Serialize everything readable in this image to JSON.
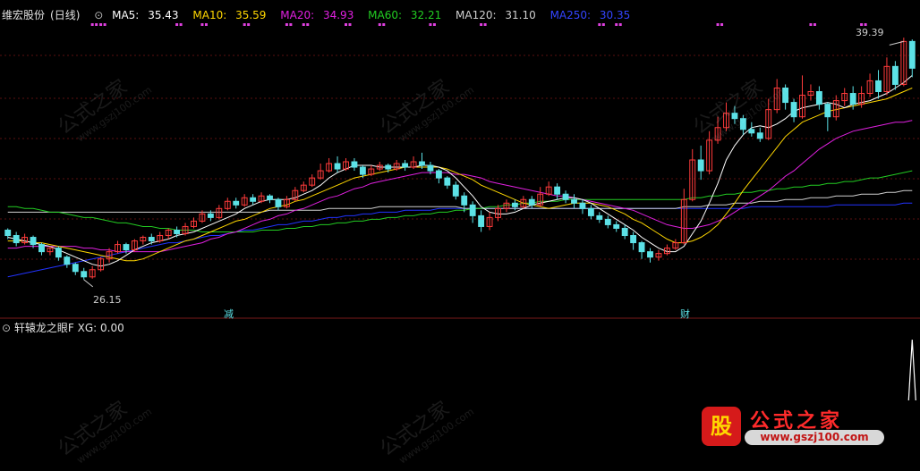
{
  "header": {
    "stock": "维宏股份",
    "period": "(日线)",
    "ma5_label": "MA5:",
    "ma5_value": "35.43",
    "ma10_label": "MA10:",
    "ma10_value": "35.59",
    "ma20_label": "MA20:",
    "ma20_value": "34.93",
    "ma60_label": "MA60:",
    "ma60_value": "32.21",
    "ma120_label": "MA120:",
    "ma120_value": "31.10",
    "ma250_label": "MA250:",
    "ma250_value": "30.35"
  },
  "colors": {
    "up": "#ff3b3b",
    "down": "#5ce1e6",
    "ma5": "#ffffff",
    "ma10": "#ffd700",
    "ma20": "#e020e0",
    "ma60": "#22cc22",
    "ma120": "#cfcfcf",
    "ma250": "#2233ff",
    "marker": "#e040e0",
    "grid": "#5a1010"
  },
  "annotations": {
    "high_price": "39.39",
    "low_price": "26.15",
    "signal_1": "减",
    "signal_2": "财"
  },
  "indicator": {
    "name": "轩辕龙之眼F",
    "xg_label": "XG:",
    "xg_value": "0.00"
  },
  "watermark": {
    "text": "公式之家",
    "url": "www.gszj100.com"
  },
  "logo": {
    "title": "公式之家",
    "url": "www.gszj100.com"
  },
  "chart_data": {
    "type": "candlestick",
    "price_range": [
      24.8,
      40.6
    ],
    "high": 39.39,
    "low": 26.15,
    "ma_last": {
      "MA5": 35.43,
      "MA10": 35.59,
      "MA20": 34.93,
      "MA60": 32.21,
      "MA120": 31.1,
      "MA250": 30.35
    },
    "candles": [
      [
        28.9,
        28.6,
        29.0,
        28.4
      ],
      [
        28.6,
        28.2,
        28.8,
        28.0
      ],
      [
        28.2,
        28.5,
        28.7,
        28.1
      ],
      [
        28.5,
        28.1,
        28.6,
        27.9
      ],
      [
        28.1,
        27.7,
        28.2,
        27.5
      ],
      [
        27.7,
        27.9,
        28.0,
        27.5
      ],
      [
        27.9,
        27.4,
        28.0,
        27.2
      ],
      [
        27.4,
        27.0,
        27.5,
        26.8
      ],
      [
        27.0,
        26.6,
        27.1,
        26.4
      ],
      [
        26.6,
        26.3,
        26.8,
        26.15
      ],
      [
        26.3,
        26.7,
        26.9,
        26.2
      ],
      [
        26.7,
        27.3,
        27.4,
        26.6
      ],
      [
        27.3,
        27.7,
        27.9,
        27.1
      ],
      [
        27.7,
        28.1,
        28.3,
        27.6
      ],
      [
        28.1,
        27.8,
        28.2,
        27.6
      ],
      [
        27.8,
        28.3,
        28.4,
        27.7
      ],
      [
        28.3,
        28.5,
        28.6,
        28.1
      ],
      [
        28.5,
        28.3,
        28.7,
        28.1
      ],
      [
        28.3,
        28.6,
        28.8,
        28.2
      ],
      [
        28.6,
        28.9,
        29.0,
        28.4
      ],
      [
        28.9,
        28.7,
        29.1,
        28.5
      ],
      [
        28.7,
        29.1,
        29.3,
        28.6
      ],
      [
        29.1,
        29.4,
        29.6,
        29.0
      ],
      [
        29.4,
        29.8,
        30.0,
        29.3
      ],
      [
        29.8,
        29.6,
        30.0,
        29.4
      ],
      [
        29.6,
        30.1,
        30.3,
        29.5
      ],
      [
        30.1,
        30.5,
        30.7,
        30.0
      ],
      [
        30.5,
        30.3,
        30.7,
        30.1
      ],
      [
        30.3,
        30.7,
        30.9,
        30.2
      ],
      [
        30.7,
        30.5,
        30.9,
        30.3
      ],
      [
        30.5,
        30.8,
        31.0,
        30.4
      ],
      [
        30.8,
        30.6,
        30.9,
        30.4
      ],
      [
        30.6,
        30.2,
        30.7,
        30.0
      ],
      [
        30.2,
        30.6,
        30.8,
        30.1
      ],
      [
        30.6,
        31.1,
        31.3,
        30.5
      ],
      [
        31.1,
        31.4,
        31.6,
        31.0
      ],
      [
        31.4,
        31.8,
        32.0,
        31.3
      ],
      [
        31.8,
        32.2,
        32.6,
        31.7
      ],
      [
        32.2,
        32.6,
        32.9,
        32.1
      ],
      [
        32.6,
        32.3,
        33.0,
        32.1
      ],
      [
        32.3,
        32.7,
        32.9,
        32.2
      ],
      [
        32.7,
        32.4,
        32.9,
        32.2
      ],
      [
        32.4,
        32.0,
        32.5,
        31.8
      ],
      [
        32.0,
        32.3,
        32.5,
        31.9
      ],
      [
        32.3,
        32.5,
        32.7,
        32.2
      ],
      [
        32.5,
        32.3,
        32.6,
        32.1
      ],
      [
        32.3,
        32.6,
        32.8,
        32.2
      ],
      [
        32.6,
        32.4,
        32.8,
        32.2
      ],
      [
        32.4,
        32.7,
        33.0,
        32.3
      ],
      [
        32.7,
        32.5,
        33.2,
        32.3
      ],
      [
        32.5,
        32.2,
        32.7,
        32.0
      ],
      [
        32.2,
        31.8,
        32.3,
        31.5
      ],
      [
        31.8,
        31.4,
        31.9,
        31.2
      ],
      [
        31.4,
        30.8,
        31.6,
        30.6
      ],
      [
        30.8,
        30.3,
        31.0,
        29.9
      ],
      [
        30.3,
        29.7,
        30.5,
        29.3
      ],
      [
        29.7,
        29.1,
        30.0,
        28.8
      ],
      [
        29.1,
        29.6,
        29.9,
        28.9
      ],
      [
        29.6,
        30.1,
        30.3,
        29.4
      ],
      [
        30.1,
        30.4,
        30.6,
        29.9
      ],
      [
        30.4,
        30.2,
        30.6,
        30.0
      ],
      [
        30.2,
        30.6,
        30.8,
        30.1
      ],
      [
        30.6,
        30.3,
        30.8,
        30.1
      ],
      [
        30.3,
        30.9,
        31.3,
        30.2
      ],
      [
        30.9,
        31.3,
        31.6,
        30.8
      ],
      [
        31.3,
        30.9,
        31.5,
        30.6
      ],
      [
        30.9,
        30.6,
        31.1,
        30.4
      ],
      [
        30.6,
        30.4,
        30.9,
        30.1
      ],
      [
        30.4,
        30.1,
        30.6,
        29.8
      ],
      [
        30.1,
        29.7,
        30.3,
        29.5
      ],
      [
        29.7,
        29.5,
        29.9,
        29.3
      ],
      [
        29.5,
        29.2,
        29.7,
        29.0
      ],
      [
        29.2,
        29.0,
        29.4,
        28.8
      ],
      [
        29.0,
        28.6,
        29.2,
        28.4
      ],
      [
        28.6,
        28.2,
        28.8,
        27.8
      ],
      [
        28.2,
        27.7,
        28.3,
        27.3
      ],
      [
        27.7,
        27.4,
        27.9,
        27.1
      ],
      [
        27.4,
        27.6,
        27.8,
        27.2
      ],
      [
        27.6,
        27.9,
        28.1,
        27.5
      ],
      [
        27.9,
        28.2,
        28.4,
        27.8
      ],
      [
        28.2,
        30.6,
        31.2,
        28.1
      ],
      [
        30.6,
        32.8,
        33.4,
        30.5
      ],
      [
        32.8,
        32.2,
        33.6,
        31.7
      ],
      [
        32.2,
        33.9,
        34.4,
        32.0
      ],
      [
        33.9,
        34.6,
        35.2,
        33.7
      ],
      [
        34.6,
        35.4,
        36.0,
        34.4
      ],
      [
        35.4,
        35.1,
        35.8,
        34.8
      ],
      [
        35.1,
        34.5,
        35.3,
        34.2
      ],
      [
        34.5,
        34.3,
        34.9,
        34.1
      ],
      [
        34.3,
        34.0,
        34.6,
        33.8
      ],
      [
        34.0,
        35.6,
        36.2,
        33.9
      ],
      [
        35.6,
        36.8,
        37.3,
        35.4
      ],
      [
        36.8,
        36.0,
        37.0,
        35.6
      ],
      [
        36.0,
        35.2,
        36.2,
        34.9
      ],
      [
        35.2,
        36.4,
        37.5,
        35.1
      ],
      [
        36.4,
        36.6,
        37.0,
        36.1
      ],
      [
        36.6,
        35.9,
        36.9,
        35.6
      ],
      [
        35.9,
        35.2,
        36.0,
        34.4
      ],
      [
        35.2,
        36.1,
        36.4,
        35.0
      ],
      [
        36.1,
        36.5,
        36.8,
        35.8
      ],
      [
        36.5,
        35.9,
        36.9,
        35.6
      ],
      [
        35.9,
        36.5,
        36.9,
        35.7
      ],
      [
        36.5,
        37.2,
        37.6,
        36.3
      ],
      [
        37.2,
        36.6,
        37.8,
        36.2
      ],
      [
        36.6,
        38.0,
        38.5,
        36.4
      ],
      [
        38.0,
        37.0,
        38.3,
        36.7
      ],
      [
        37.0,
        39.39,
        39.6,
        36.9
      ],
      [
        39.39,
        37.9,
        39.5,
        37.4
      ]
    ],
    "ma5": [
      28.5,
      28.4,
      28.3,
      28.2,
      28.1,
      28.0,
      27.8,
      27.6,
      27.4,
      27.2,
      27.0,
      26.9,
      27.0,
      27.2,
      27.5,
      27.8,
      28.0,
      28.2,
      28.3,
      28.4,
      28.6,
      28.7,
      28.8,
      29.0,
      29.2,
      29.4,
      29.6,
      29.8,
      30.1,
      30.3,
      30.5,
      30.6,
      30.6,
      30.6,
      30.7,
      30.9,
      31.1,
      31.4,
      31.8,
      32.1,
      32.3,
      32.5,
      32.5,
      32.5,
      32.4,
      32.4,
      32.4,
      32.4,
      32.4,
      32.5,
      32.5,
      32.4,
      32.2,
      31.8,
      31.3,
      30.8,
      30.2,
      29.9,
      29.8,
      29.8,
      29.9,
      30.1,
      30.3,
      30.4,
      30.5,
      30.6,
      30.7,
      30.7,
      30.6,
      30.4,
      30.1,
      29.8,
      29.5,
      29.2,
      28.9,
      28.5,
      28.2,
      27.9,
      27.7,
      27.7,
      28.0,
      28.7,
      29.4,
      30.4,
      31.5,
      32.8,
      33.6,
      34.2,
      34.6,
      34.7,
      34.6,
      34.8,
      35.1,
      35.5,
      35.7,
      35.8,
      35.9,
      36.0,
      35.9,
      35.7,
      35.9,
      36.0,
      36.1,
      36.3,
      36.5,
      36.8,
      37.1,
      37.5
    ],
    "ma10": [
      28.3,
      28.3,
      28.3,
      28.2,
      28.2,
      28.1,
      28.0,
      27.9,
      27.8,
      27.7,
      27.6,
      27.5,
      27.4,
      27.3,
      27.2,
      27.2,
      27.3,
      27.5,
      27.7,
      27.9,
      28.1,
      28.3,
      28.4,
      28.6,
      28.8,
      29.0,
      29.2,
      29.4,
      29.5,
      29.7,
      29.9,
      30.1,
      30.2,
      30.3,
      30.5,
      30.6,
      30.8,
      31.0,
      31.2,
      31.4,
      31.6,
      31.8,
      31.9,
      32.0,
      32.1,
      32.2,
      32.3,
      32.4,
      32.4,
      32.4,
      32.4,
      32.4,
      32.3,
      32.1,
      31.9,
      31.7,
      31.4,
      31.2,
      31.0,
      30.8,
      30.6,
      30.4,
      30.3,
      30.2,
      30.1,
      30.2,
      30.3,
      30.4,
      30.4,
      30.4,
      30.3,
      30.2,
      30.0,
      29.8,
      29.5,
      29.3,
      29.0,
      28.7,
      28.4,
      28.2,
      28.2,
      28.3,
      28.5,
      28.8,
      29.2,
      29.8,
      30.4,
      31.1,
      31.7,
      32.3,
      32.9,
      33.5,
      34.1,
      34.5,
      34.9,
      35.1,
      35.3,
      35.5,
      35.6,
      35.7,
      35.8,
      35.9,
      36.0,
      36.1,
      36.2,
      36.4,
      36.6,
      36.8
    ],
    "ma20": [
      27.9,
      27.9,
      28.0,
      28.0,
      28.0,
      28.0,
      28.0,
      28.0,
      28.0,
      27.9,
      27.9,
      27.8,
      27.8,
      27.7,
      27.7,
      27.7,
      27.7,
      27.7,
      27.7,
      27.8,
      27.9,
      28.0,
      28.1,
      28.2,
      28.4,
      28.5,
      28.7,
      28.8,
      29.0,
      29.2,
      29.4,
      29.5,
      29.7,
      29.8,
      30.0,
      30.1,
      30.3,
      30.5,
      30.7,
      30.8,
      31.0,
      31.2,
      31.3,
      31.5,
      31.6,
      31.7,
      31.8,
      31.9,
      32.0,
      32.1,
      32.1,
      32.1,
      32.1,
      32.0,
      32.0,
      31.9,
      31.8,
      31.6,
      31.5,
      31.4,
      31.3,
      31.2,
      31.1,
      31.0,
      30.9,
      30.8,
      30.8,
      30.7,
      30.6,
      30.5,
      30.4,
      30.3,
      30.2,
      30.1,
      30.0,
      29.8,
      29.6,
      29.4,
      29.2,
      29.1,
      29.0,
      29.0,
      29.1,
      29.2,
      29.4,
      29.6,
      29.9,
      30.2,
      30.5,
      30.8,
      31.1,
      31.5,
      31.9,
      32.2,
      32.6,
      33.0,
      33.4,
      33.7,
      34.0,
      34.2,
      34.4,
      34.5,
      34.6,
      34.7,
      34.8,
      34.9,
      34.9,
      35.0
    ],
    "ma60": [
      30.2,
      30.2,
      30.1,
      30.1,
      30.0,
      29.9,
      29.9,
      29.8,
      29.7,
      29.6,
      29.6,
      29.5,
      29.4,
      29.3,
      29.3,
      29.2,
      29.1,
      29.1,
      29.0,
      29.0,
      28.9,
      28.9,
      28.9,
      28.8,
      28.8,
      28.8,
      28.8,
      28.8,
      28.8,
      28.8,
      28.9,
      28.9,
      28.9,
      29.0,
      29.0,
      29.1,
      29.1,
      29.2,
      29.2,
      29.3,
      29.3,
      29.4,
      29.4,
      29.5,
      29.5,
      29.6,
      29.6,
      29.7,
      29.7,
      29.8,
      29.8,
      29.9,
      29.9,
      30.0,
      30.0,
      30.1,
      30.1,
      30.2,
      30.2,
      30.3,
      30.3,
      30.4,
      30.4,
      30.5,
      30.5,
      30.5,
      30.6,
      30.6,
      30.6,
      30.6,
      30.6,
      30.6,
      30.6,
      30.6,
      30.6,
      30.6,
      30.6,
      30.6,
      30.6,
      30.6,
      30.6,
      30.7,
      30.7,
      30.8,
      30.8,
      30.9,
      30.9,
      31.0,
      31.0,
      31.1,
      31.1,
      31.2,
      31.2,
      31.3,
      31.3,
      31.4,
      31.4,
      31.5,
      31.5,
      31.6,
      31.6,
      31.7,
      31.8,
      31.8,
      31.9,
      32.0,
      32.1,
      32.2
    ],
    "ma120": [
      29.9,
      29.9,
      29.9,
      29.9,
      29.9,
      29.9,
      29.9,
      29.9,
      29.9,
      29.9,
      29.9,
      29.9,
      29.9,
      29.9,
      29.9,
      29.9,
      29.9,
      29.9,
      29.9,
      29.9,
      29.9,
      29.9,
      29.9,
      29.9,
      29.9,
      29.9,
      29.9,
      29.9,
      29.9,
      29.9,
      29.9,
      30.0,
      30.0,
      30.0,
      30.0,
      30.0,
      30.0,
      30.0,
      30.1,
      30.1,
      30.1,
      30.1,
      30.1,
      30.1,
      30.2,
      30.2,
      30.2,
      30.2,
      30.2,
      30.2,
      30.2,
      30.2,
      30.2,
      30.2,
      30.1,
      30.1,
      30.1,
      30.1,
      30.1,
      30.1,
      30.1,
      30.1,
      30.1,
      30.1,
      30.1,
      30.1,
      30.1,
      30.1,
      30.1,
      30.1,
      30.1,
      30.1,
      30.1,
      30.1,
      30.1,
      30.1,
      30.1,
      30.1,
      30.1,
      30.1,
      30.2,
      30.2,
      30.2,
      30.3,
      30.3,
      30.3,
      30.4,
      30.4,
      30.4,
      30.5,
      30.5,
      30.5,
      30.6,
      30.6,
      30.6,
      30.7,
      30.7,
      30.7,
      30.8,
      30.8,
      30.8,
      30.9,
      30.9,
      30.9,
      31.0,
      31.0,
      31.1,
      31.1
    ],
    "ma250": [
      26.3,
      26.4,
      26.5,
      26.6,
      26.7,
      26.8,
      26.9,
      27.0,
      27.1,
      27.2,
      27.3,
      27.4,
      27.5,
      27.6,
      27.7,
      27.8,
      27.9,
      28.0,
      28.1,
      28.2,
      28.2,
      28.3,
      28.4,
      28.5,
      28.6,
      28.6,
      28.7,
      28.8,
      28.9,
      28.9,
      29.0,
      29.1,
      29.2,
      29.2,
      29.3,
      29.4,
      29.4,
      29.5,
      29.6,
      29.6,
      29.7,
      29.7,
      29.8,
      29.8,
      29.9,
      29.9,
      29.9,
      30.0,
      30.0,
      30.0,
      30.0,
      30.1,
      30.1,
      30.1,
      30.1,
      30.1,
      30.1,
      30.1,
      30.1,
      30.1,
      30.1,
      30.1,
      30.1,
      30.1,
      30.1,
      30.1,
      30.1,
      30.1,
      30.1,
      30.1,
      30.1,
      30.1,
      30.1,
      30.1,
      30.1,
      30.1,
      30.1,
      30.1,
      30.1,
      30.1,
      30.1,
      30.1,
      30.1,
      30.1,
      30.1,
      30.1,
      30.1,
      30.1,
      30.2,
      30.2,
      30.2,
      30.2,
      30.2,
      30.2,
      30.2,
      30.2,
      30.2,
      30.2,
      30.3,
      30.3,
      30.3,
      30.3,
      30.3,
      30.3,
      30.3,
      30.3,
      30.4,
      30.4
    ],
    "markers_candle_index": [
      10,
      11,
      20,
      23,
      28,
      33,
      35,
      40,
      44,
      50,
      56,
      70,
      72,
      84,
      95,
      101
    ],
    "xg_spike_index": 107,
    "signal_1_index": 40,
    "signal_2_index": 97
  }
}
